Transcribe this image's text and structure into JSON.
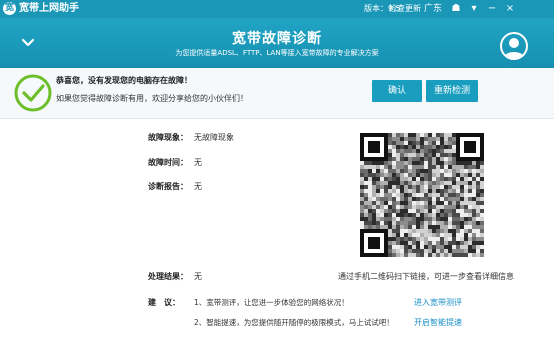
{
  "titlebar": {
    "logo_glyph": "宽",
    "title": "宽带上网助手",
    "version": "版本：9.5",
    "update_label": "检查更新",
    "region": "广东",
    "skin_glyph": "☗",
    "menu_glyph": "▾",
    "minimize_glyph": "−",
    "close_glyph": "×"
  },
  "header": {
    "title": "宽带故障诊断",
    "subtitle": "为您提供适量ADSL、FTTP、LAN等接入宽带故障的专业解决方案"
  },
  "summary": {
    "congrats": "恭喜您，没有发现您的电脑存在故障！",
    "share": "如果您觉得故障诊断有用，欢迎分享给您的小伙伴们！",
    "confirm_label": "确认",
    "recheck_label": "重新检测"
  },
  "details": {
    "symptom_label": "故障现象：",
    "symptom_value": "无故障现象",
    "time_label": "故障时间：",
    "time_value": "无",
    "report_label": "诊断报告：",
    "report_value": "无",
    "result_label": "处理结果：",
    "result_value": "无"
  },
  "qr": {
    "caption": "通过手机二维码扫下链接，可进一步查看详细信息"
  },
  "suggestions": {
    "label": "建　议：",
    "items": [
      {
        "text": "1、宽带测评，让您进一步体验您的网络状况！",
        "link": "进入宽带测评"
      },
      {
        "text": "2、智能提速，为您提供随开随停的极限模式，马上试试吧！",
        "link": "开启智能提速"
      }
    ]
  },
  "colors": {
    "accent": "#1a97b7",
    "button": "#1a9ec0",
    "success": "#6cbf2a",
    "link": "#1a8fc8"
  }
}
